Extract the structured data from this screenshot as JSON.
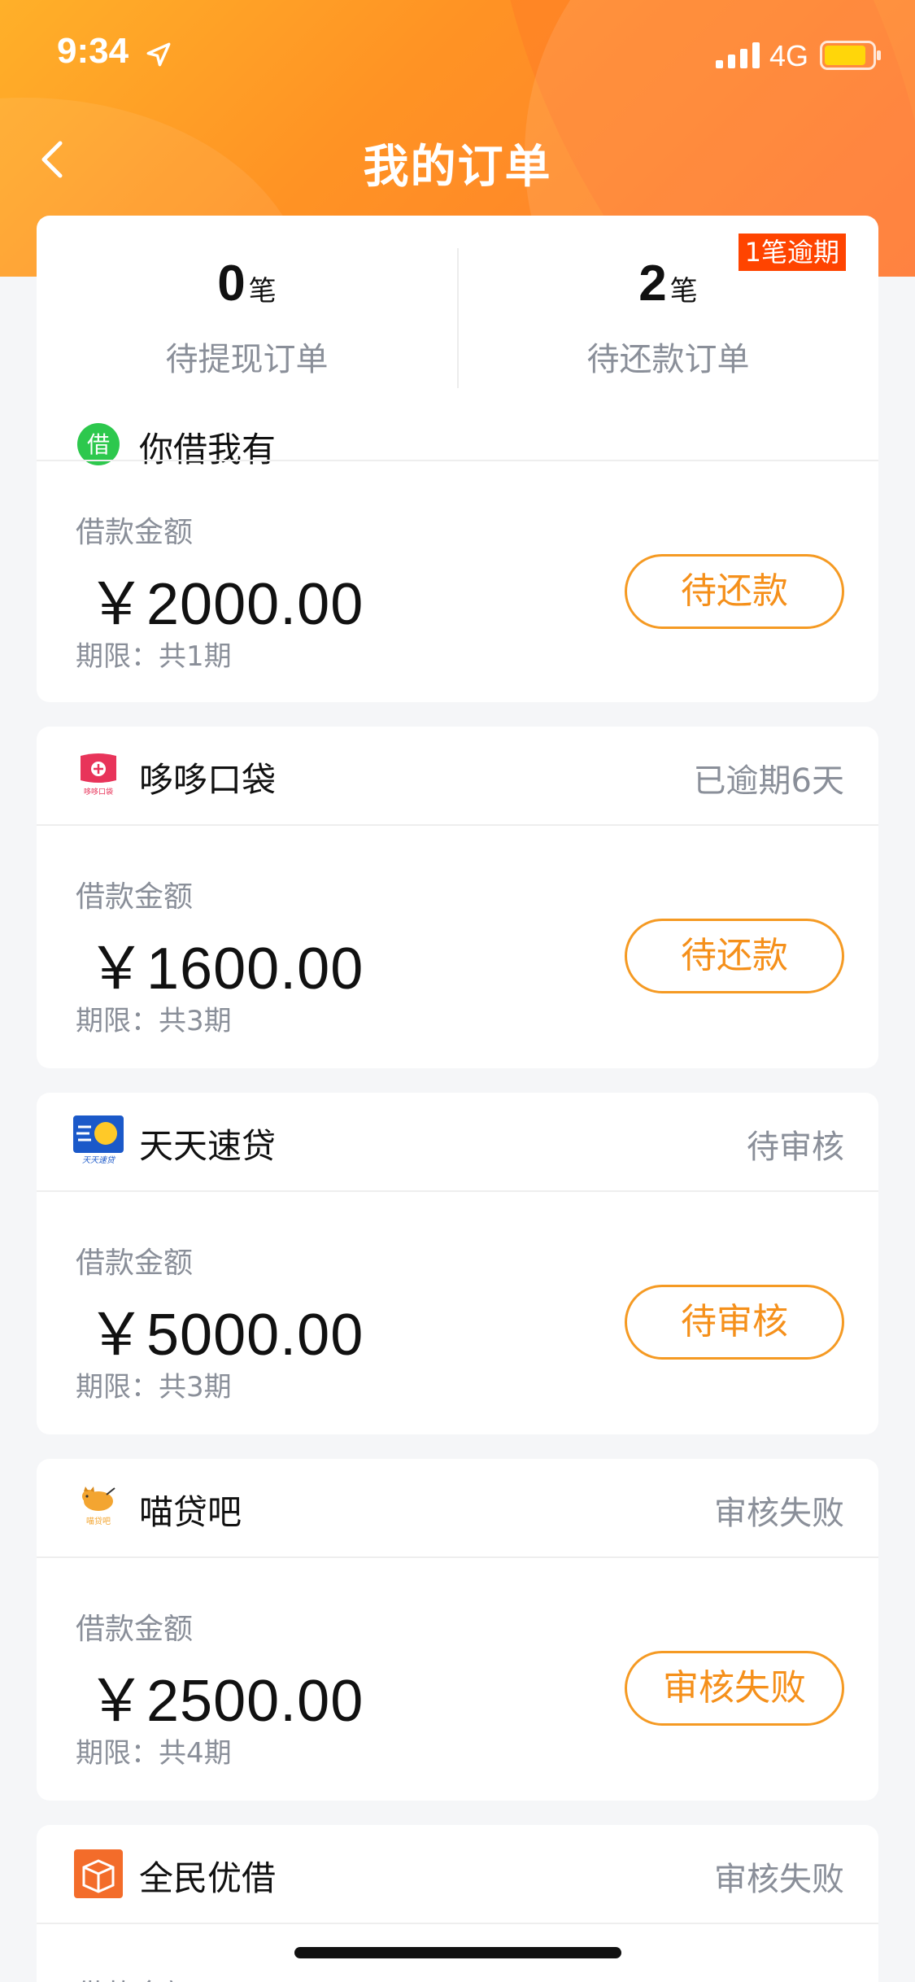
{
  "status_bar": {
    "time": "9:34",
    "network": "4G"
  },
  "nav": {
    "title": "我的订单"
  },
  "summary": {
    "pending_withdraw": {
      "count": "0",
      "unit": "笔",
      "label": "待提现订单"
    },
    "pending_repay": {
      "count": "2",
      "unit": "笔",
      "label": "待还款订单"
    },
    "overdue_badge": "1笔逾期"
  },
  "orders": [
    {
      "name": "你借我有",
      "status": "",
      "amount_label": "借款金额",
      "amount": "￥2000.00",
      "term": "期限：共1期",
      "button": "待还款"
    },
    {
      "name": "哆哆口袋",
      "status": "已逾期6天",
      "amount_label": "借款金额",
      "amount": "￥1600.00",
      "term": "期限：共3期",
      "button": "待还款"
    },
    {
      "name": "天天速贷",
      "status": "待审核",
      "amount_label": "借款金额",
      "amount": "￥5000.00",
      "term": "期限：共3期",
      "button": "待审核"
    },
    {
      "name": "喵贷吧",
      "status": "审核失败",
      "amount_label": "借款金额",
      "amount": "￥2500.00",
      "term": "期限：共4期",
      "button": "审核失败"
    },
    {
      "name": "全民优借",
      "status": "审核失败",
      "amount_label": "借款金额"
    }
  ],
  "logos": {
    "order0": {
      "icon": "borrow-circle-icon",
      "glyph": "借"
    },
    "order1": {
      "icon": "pocket-bag-icon",
      "text": "哆哆口袋"
    },
    "order2": {
      "icon": "speed-loan-icon",
      "text": "天天速贷"
    },
    "order3": {
      "icon": "cat-mascot-icon",
      "text": "喵贷吧"
    },
    "order4": {
      "icon": "box-icon"
    }
  },
  "colors": {
    "header_gradient_start": "#ffb029",
    "header_gradient_end": "#ff7b2e",
    "accent_orange": "#f5901b",
    "overdue_red": "#ff4400",
    "gray_text": "#8a8f99"
  }
}
